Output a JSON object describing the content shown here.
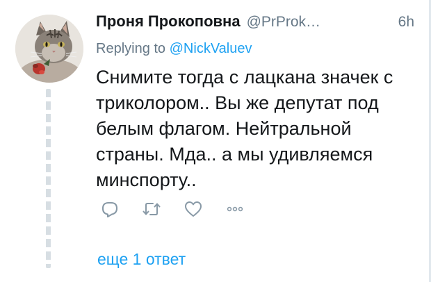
{
  "tweet": {
    "author_name": "Проня Прокоповна",
    "author_handle": "@PrProk…",
    "time": "6h",
    "replying_to_prefix": "Replying to",
    "replying_to_handle": "@NickValuev",
    "text": "Снимите тогда с лацкана значек с триколором.. Вы же депутат под белым флагом. Нейтральной страны. Мда.. а мы удивляемся минспорту.."
  },
  "actions": [
    {
      "name": "reply",
      "icon": "reply-icon"
    },
    {
      "name": "retweet",
      "icon": "retweet-icon"
    },
    {
      "name": "like",
      "icon": "heart-icon"
    },
    {
      "name": "more",
      "icon": "more-icon"
    }
  ],
  "more_replies_label": "еще 1 ответ",
  "colors": {
    "text": "#14171a",
    "secondary": "#657786",
    "link": "#1da1f2",
    "icon": "#8899a6",
    "thread_line": "#d7dee3"
  }
}
